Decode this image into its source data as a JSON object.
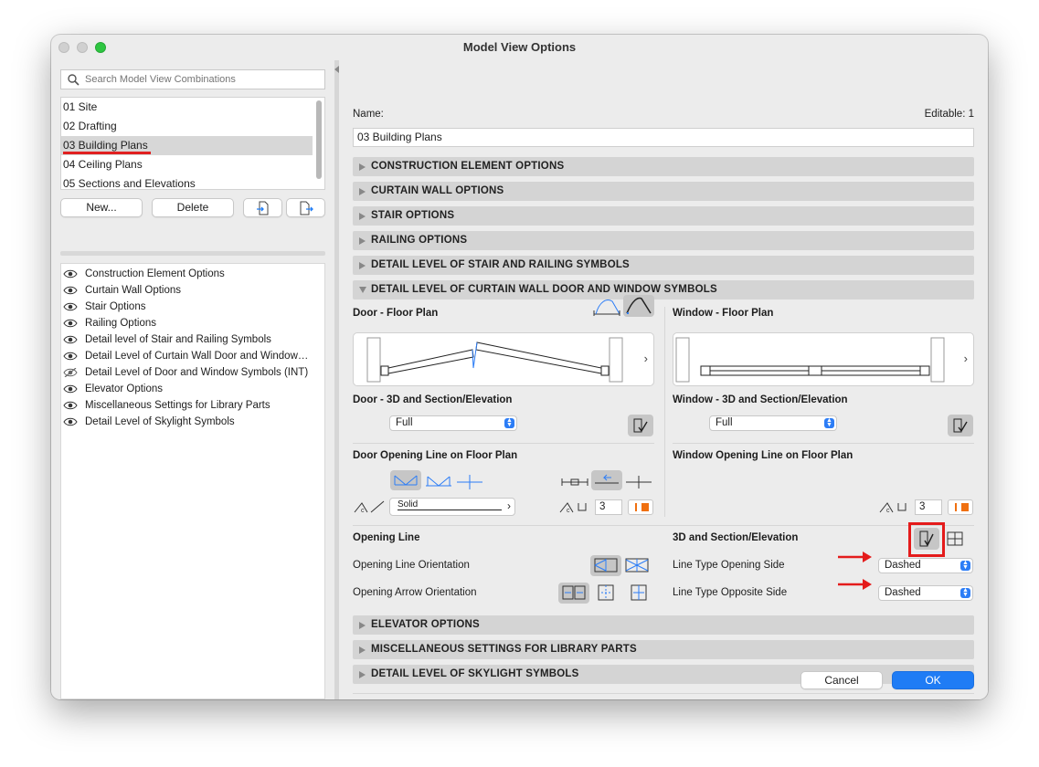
{
  "window": {
    "title": "Model View Options"
  },
  "left": {
    "search_placeholder": "Search Model View Combinations",
    "combinations": [
      {
        "label": "01 Site",
        "selected": false
      },
      {
        "label": "02 Drafting",
        "selected": false
      },
      {
        "label": "03 Building Plans",
        "selected": true
      },
      {
        "label": "04 Ceiling Plans",
        "selected": false
      },
      {
        "label": "05 Sections and Elevations",
        "selected": false
      }
    ],
    "buttons": {
      "new": "New...",
      "delete": "Delete"
    },
    "options": [
      {
        "label": "Construction Element Options",
        "visible": true
      },
      {
        "label": "Curtain Wall Options",
        "visible": true
      },
      {
        "label": "Stair Options",
        "visible": true
      },
      {
        "label": "Railing Options",
        "visible": true
      },
      {
        "label": "Detail level of Stair and Railing Symbols",
        "visible": true
      },
      {
        "label": "Detail Level of Curtain Wall Door and Window…",
        "visible": true
      },
      {
        "label": "Detail Level of Door and Window Symbols (INT)",
        "visible": false
      },
      {
        "label": "Elevator Options",
        "visible": true
      },
      {
        "label": "Miscellaneous Settings for Library Parts",
        "visible": true
      },
      {
        "label": "Detail Level of Skylight Symbols",
        "visible": true
      }
    ]
  },
  "right": {
    "name_label": "Name:",
    "editable_label": "Editable: 1",
    "name_value": "03 Building Plans",
    "sections": {
      "construction": "CONSTRUCTION ELEMENT OPTIONS",
      "curtain_wall": "CURTAIN WALL OPTIONS",
      "stair": "STAIR OPTIONS",
      "railing": "RAILING OPTIONS",
      "detail_stair": "DETAIL LEVEL OF STAIR AND RAILING SYMBOLS",
      "detail_cw": "DETAIL LEVEL OF CURTAIN WALL DOOR AND WINDOW SYMBOLS",
      "elevator": "ELEVATOR OPTIONS",
      "misc": "MISCELLANEOUS SETTINGS FOR LIBRARY PARTS",
      "skylight": "DETAIL LEVEL OF SKYLIGHT SYMBOLS"
    },
    "door_floor_plan": "Door - Floor Plan",
    "window_floor_plan": "Window - Floor Plan",
    "door_3d": "Door - 3D and Section/Elevation",
    "window_3d": "Window - 3D and Section/Elevation",
    "door_3d_value": "Full",
    "window_3d_value": "Full",
    "door_opening_line": "Door Opening Line on Floor Plan",
    "window_opening_line": "Window Opening Line on Floor Plan",
    "door_line_type": "Solid",
    "door_pen": "3",
    "window_pen": "3",
    "opening_line": "Opening Line",
    "opening_line_orientation": "Opening Line Orientation",
    "opening_arrow_orientation": "Opening Arrow Orientation",
    "section_3d": "3D and Section/Elevation",
    "line_type_opening_side": "Line Type Opening Side",
    "line_type_opening_value": "Dashed",
    "line_type_opposite_side": "Line Type Opposite Side",
    "line_type_opposite_value": "Dashed"
  },
  "footer": {
    "cancel": "Cancel",
    "ok": "OK"
  },
  "colors": {
    "accent": "#1f7cf5",
    "annotation": "#e41b1b",
    "pen": "#f07010"
  }
}
